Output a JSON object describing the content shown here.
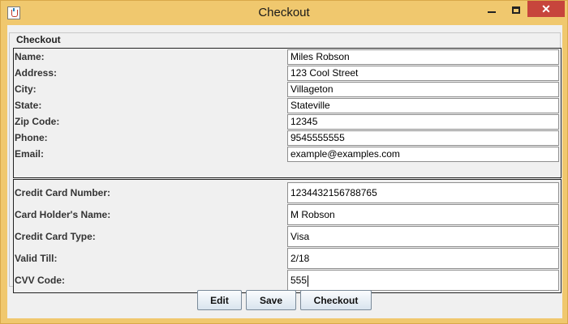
{
  "window": {
    "title": "Checkout",
    "close_glyph": "✕"
  },
  "group": {
    "title": "Checkout"
  },
  "personal": [
    {
      "label": "Name:",
      "value": "Miles Robson"
    },
    {
      "label": "Address:",
      "value": "123 Cool Street"
    },
    {
      "label": "City:",
      "value": "Villageton"
    },
    {
      "label": "State:",
      "value": "Stateville"
    },
    {
      "label": "Zip Code:",
      "value": "12345"
    },
    {
      "label": "Phone:",
      "value": "9545555555"
    },
    {
      "label": "Email:",
      "value": "example@examples.com"
    }
  ],
  "card": [
    {
      "label": "Credit Card Number:",
      "value": "1234432156788765"
    },
    {
      "label": "Card Holder's Name:",
      "value": "M Robson"
    },
    {
      "label": "Credit Card Type:",
      "value": "Visa"
    },
    {
      "label": "Valid Till:",
      "value": "2/18"
    },
    {
      "label": "CVV Code:",
      "value": "555"
    }
  ],
  "buttons": {
    "edit": "Edit",
    "save": "Save",
    "checkout": "Checkout"
  },
  "colors": {
    "title_bar": "#f0c86e",
    "close_button": "#c7453c",
    "background": "#f0f0f0"
  }
}
